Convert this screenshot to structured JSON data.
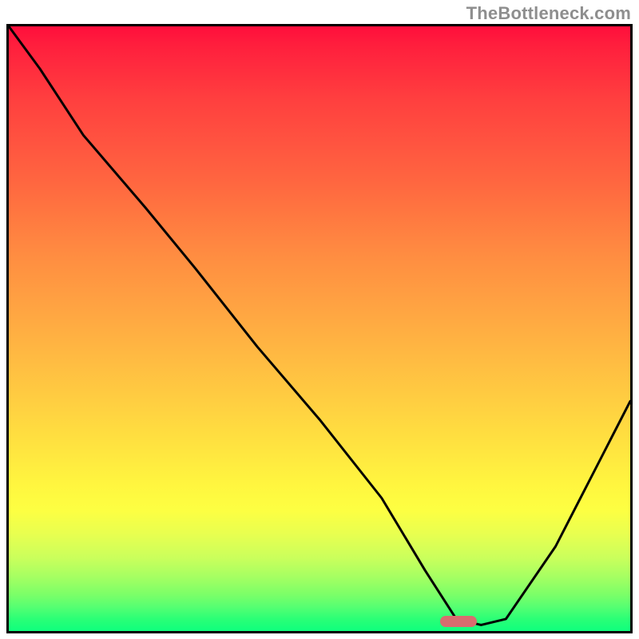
{
  "watermark": "TheBottleneck.com",
  "colors": {
    "border": "#000000",
    "curve": "#000000",
    "marker": "#d86c6f",
    "gradient_top": "#ff0e3c",
    "gradient_mid": "#ffe03f",
    "gradient_bottom": "#0fff7d"
  },
  "chart_data": {
    "type": "line",
    "title": "",
    "xlabel": "",
    "ylabel": "",
    "xlim": [
      0,
      100
    ],
    "ylim": [
      0,
      100
    ],
    "grid": false,
    "legend": null,
    "annotations": [
      {
        "kind": "marker",
        "x_start": 70,
        "x_end": 76,
        "y": 1,
        "color": "#d86c6f"
      }
    ],
    "series": [
      {
        "name": "bottleneck-curve",
        "x": [
          0,
          5,
          12,
          22,
          30,
          40,
          50,
          60,
          67,
          72,
          76,
          80,
          88,
          95,
          100
        ],
        "y": [
          100,
          93,
          82,
          70,
          60,
          47,
          35,
          22,
          10,
          2,
          1,
          2,
          14,
          28,
          38
        ]
      }
    ]
  }
}
